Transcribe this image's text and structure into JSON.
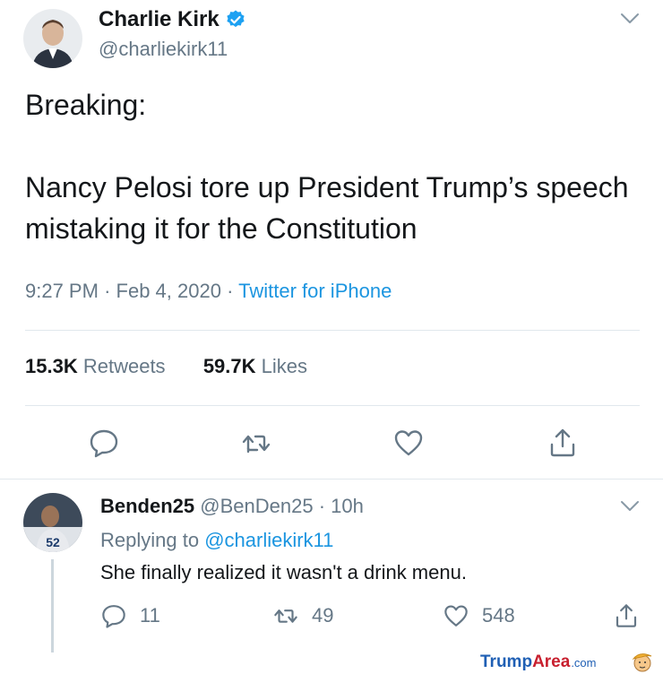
{
  "tweet": {
    "author": {
      "display_name": "Charlie Kirk",
      "handle": "@charliekirk11",
      "verified": true,
      "avatar_icon": "profile-photo"
    },
    "text": "Breaking:\n\nNancy Pelosi tore up President Trump’s speech mistaking it for the Constitution",
    "time": "9:27 PM",
    "separator": "·",
    "date": "Feb 4, 2020",
    "source": "Twitter for iPhone",
    "retweets_count": "15.3K",
    "retweets_label": "Retweets",
    "likes_count": "59.7K",
    "likes_label": "Likes",
    "actions": [
      "reply-icon",
      "retweet-icon",
      "like-icon",
      "share-icon"
    ]
  },
  "reply": {
    "display_name": "Benden25",
    "handle": "@BenDen25",
    "separator": "·",
    "age": "10h",
    "replying_prefix": "Replying to",
    "replying_to": "@charliekirk11",
    "text": "She finally realized it wasn't a drink menu.",
    "reply_count": "11",
    "retweet_count": "49",
    "like_count": "548",
    "avatar_icon": "profile-photo"
  },
  "watermark": {
    "part1": "Trump",
    "part2": "Area",
    "part3": ".com"
  },
  "colors": {
    "link_blue": "#1b95e0",
    "muted_gray": "#657786",
    "text": "#14171a",
    "divider": "#e1e8ed",
    "verified_blue": "#1da1f2"
  }
}
